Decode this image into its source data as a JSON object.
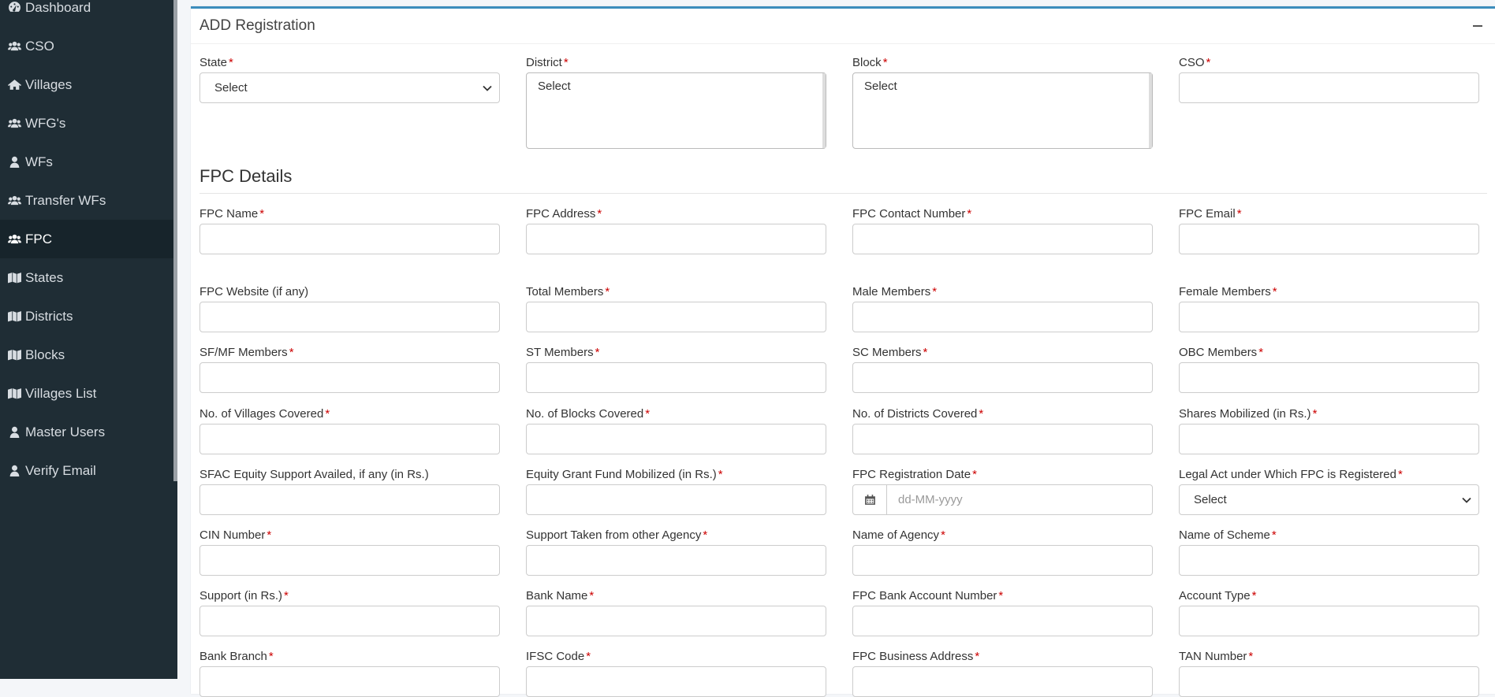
{
  "sidebar": {
    "items": [
      {
        "label": "Dashboard",
        "icon": "dashboard-icon"
      },
      {
        "label": "CSO",
        "icon": "users-icon"
      },
      {
        "label": "Villages",
        "icon": "home-icon"
      },
      {
        "label": "WFG's",
        "icon": "users-icon"
      },
      {
        "label": "WFs",
        "icon": "user-icon"
      },
      {
        "label": "Transfer WFs",
        "icon": "users-icon"
      },
      {
        "label": "FPC",
        "icon": "users-icon",
        "active": true
      },
      {
        "label": "States",
        "icon": "map-icon"
      },
      {
        "label": "Districts",
        "icon": "map-icon"
      },
      {
        "label": "Blocks",
        "icon": "map-icon"
      },
      {
        "label": "Villages List",
        "icon": "map-icon"
      },
      {
        "label": "Master Users",
        "icon": "user-icon"
      },
      {
        "label": "Verify Email",
        "icon": "user-icon"
      }
    ]
  },
  "card": {
    "title": "ADD Registration",
    "section_title": "FPC Details"
  },
  "location": {
    "state": {
      "label": "State",
      "value": "Select"
    },
    "district": {
      "label": "District",
      "value": "Select"
    },
    "block": {
      "label": "Block",
      "value": "Select"
    },
    "cso": {
      "label": "CSO"
    }
  },
  "required_mark": "*",
  "fields": {
    "fpc_name": "FPC Name",
    "fpc_address": "FPC Address",
    "fpc_contact": "FPC Contact Number",
    "fpc_email": "FPC Email",
    "fpc_website": "FPC Website (if any)",
    "total_members": "Total Members",
    "male_members": "Male Members",
    "female_members": "Female Members",
    "sfmf_members": "SF/MF Members",
    "st_members": "ST Members",
    "sc_members": "SC Members",
    "obc_members": "OBC Members",
    "villages_covered": "No. of Villages Covered",
    "blocks_covered": "No. of Blocks Covered",
    "districts_covered": "No. of Districts Covered",
    "shares_mobilized": "Shares Mobilized (in Rs.)",
    "sfac_equity": "SFAC Equity Support Availed, if any (in Rs.)",
    "equity_grant": "Equity Grant Fund Mobilized (in Rs.)",
    "registration_date": "FPC Registration Date",
    "legal_act": "Legal Act under Which FPC is Registered",
    "cin_number": "CIN Number",
    "support_other_agency": "Support Taken from other Agency",
    "name_of_agency": "Name of Agency",
    "name_of_scheme": "Name of Scheme",
    "support_rs": "Support (in Rs.)",
    "bank_name": "Bank Name",
    "bank_account": "FPC Bank Account Number",
    "account_type": "Account Type",
    "bank_branch": "Bank Branch",
    "ifsc_code": "IFSC Code",
    "business_address": "FPC Business Address",
    "tan_number": "TAN Number"
  },
  "registration_date_placeholder": "dd-MM-yyyy",
  "legal_act_value": "Select"
}
